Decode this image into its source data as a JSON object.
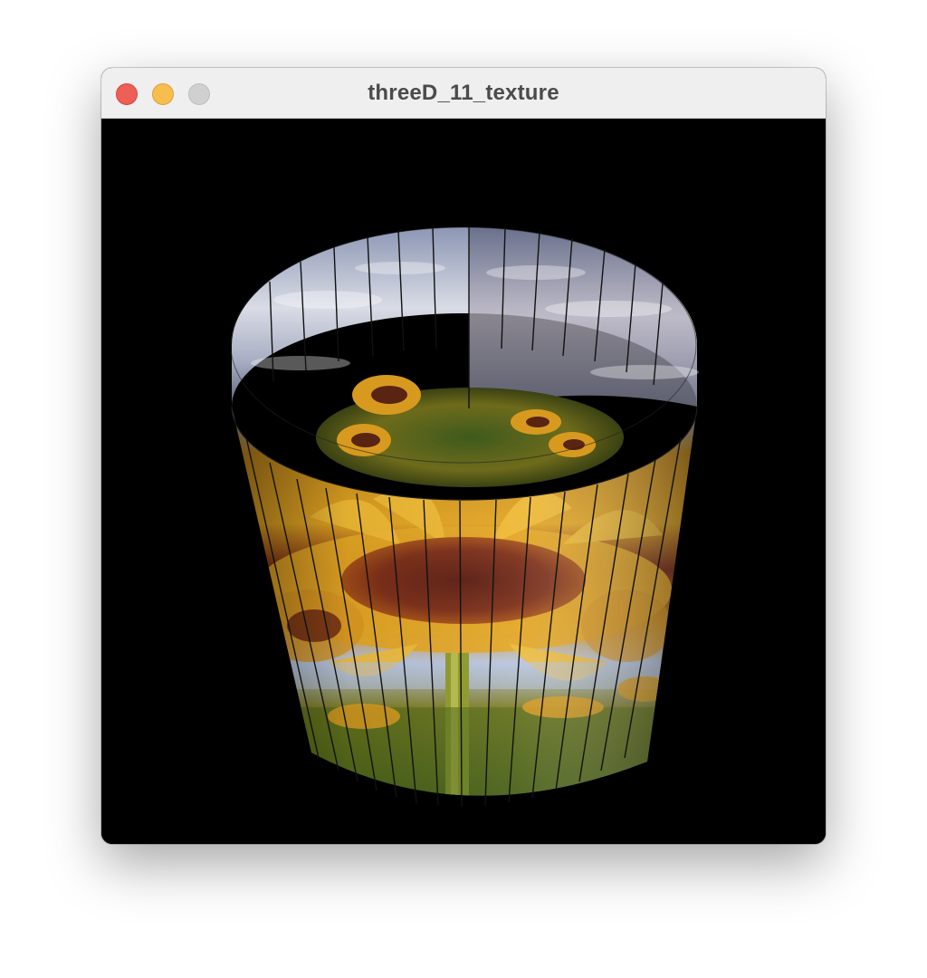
{
  "window": {
    "title": "threeD_11_texture",
    "background": "#000000"
  },
  "titlebar": {
    "buttons": [
      {
        "name": "close-button",
        "color": "#ee5f57"
      },
      {
        "name": "minimize-button",
        "color": "#f6be4f"
      },
      {
        "name": "zoom-button",
        "color": "#d0d0d0"
      }
    ]
  },
  "scene": {
    "object": "textured cylinder",
    "texture": "sunflower field under cloudy sky",
    "segments": 24
  }
}
